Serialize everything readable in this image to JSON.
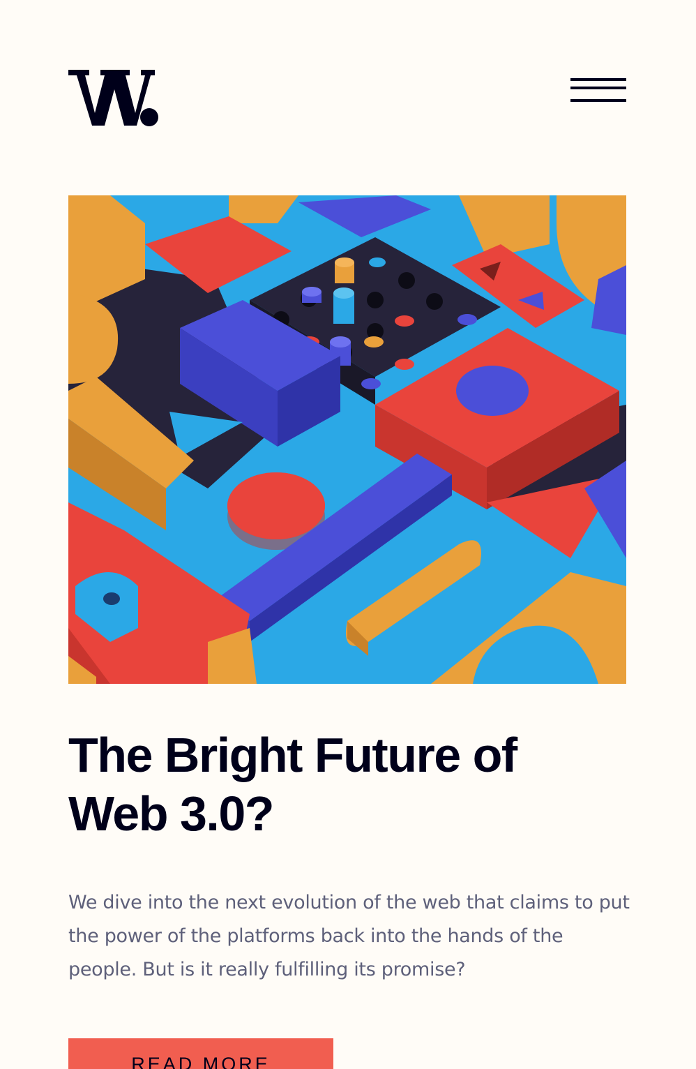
{
  "header": {
    "logo_text": "W.",
    "menu_icon": "hamburger-menu-icon"
  },
  "hero": {
    "image": "colorful-3d-geometric-blocks-illustration"
  },
  "article": {
    "title": "The Bright Future of Web 3.0?",
    "description": "We dive into the next evolution of the web that claims to put the power of the platforms back into the hands of the people. But is it really fulfilling its promise?",
    "cta_label": "READ MORE"
  },
  "colors": {
    "background": "#FFFCF7",
    "text_dark": "#00001A",
    "text_muted": "#5E607A",
    "accent": "#F15E50",
    "block_orange": "#E9A03B",
    "block_red": "#E9443C",
    "block_blue": "#4B4FD8",
    "block_cyan": "#2BA8E6",
    "block_navy": "#26233A"
  }
}
